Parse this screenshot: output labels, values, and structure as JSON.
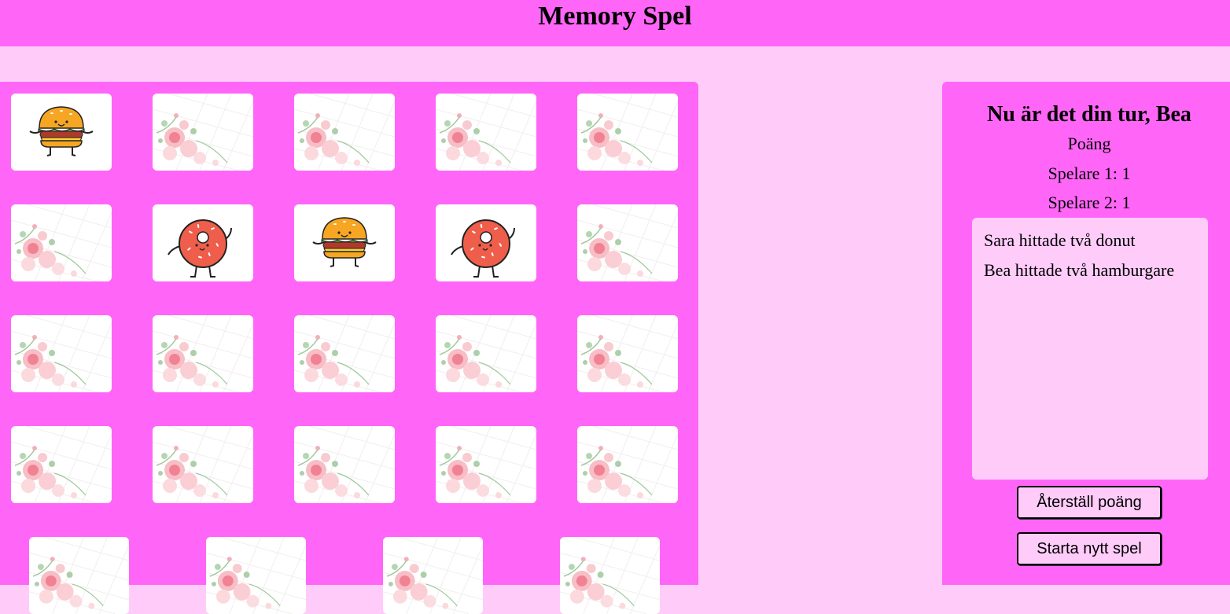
{
  "header": {
    "title": "Memory Spel"
  },
  "board": {
    "cards": [
      {
        "face": "burger"
      },
      {
        "face": "back"
      },
      {
        "face": "back"
      },
      {
        "face": "back"
      },
      {
        "face": "back"
      },
      {
        "face": "back"
      },
      {
        "face": "donut"
      },
      {
        "face": "burger"
      },
      {
        "face": "donut"
      },
      {
        "face": "back"
      },
      {
        "face": "back"
      },
      {
        "face": "back"
      },
      {
        "face": "back"
      },
      {
        "face": "back"
      },
      {
        "face": "back"
      },
      {
        "face": "back"
      },
      {
        "face": "back"
      },
      {
        "face": "back"
      },
      {
        "face": "back"
      },
      {
        "face": "back"
      },
      {
        "face": "back"
      },
      {
        "face": "back"
      },
      {
        "face": "back"
      },
      {
        "face": "back"
      }
    ]
  },
  "panel": {
    "turn_text": "Nu är det din tur, Bea",
    "score_label": "Poäng",
    "scores": [
      "Spelare 1: 1",
      "Spelare 2: 1"
    ],
    "log": [
      "Sara hittade två donut",
      "Bea hittade två hamburgare"
    ],
    "reset_button": "Återställ poäng",
    "new_game_button": "Starta nytt spel"
  },
  "colors": {
    "accent": "#ff66f8",
    "background": "#ffccfa",
    "card": "#ffffff"
  }
}
